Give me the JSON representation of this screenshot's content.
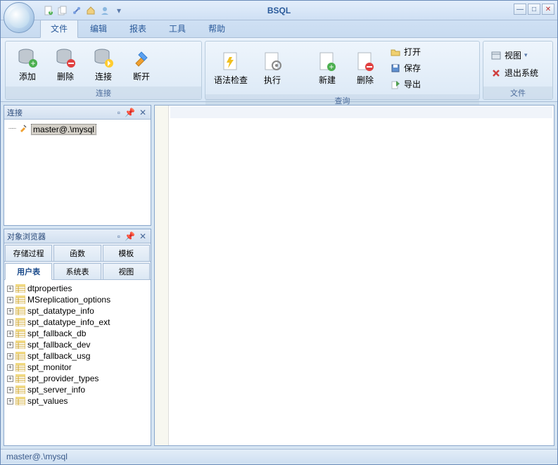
{
  "app": {
    "title": "BSQL"
  },
  "tabs": [
    "文件",
    "编辑",
    "报表",
    "工具",
    "帮助"
  ],
  "ribbon": {
    "conn_group": "连接",
    "query_group": "查询",
    "file_group": "文件",
    "add": "添加",
    "delete": "删除",
    "connect": "连接",
    "disconnect": "断开",
    "syntax": "语法检查",
    "execute": "执行",
    "new": "新建",
    "del2": "删除",
    "open": "打开",
    "save": "保存",
    "export": "导出",
    "view": "视图",
    "exit": "退出系统"
  },
  "panels": {
    "conn": "连接",
    "obj_browser": "对象浏览器"
  },
  "tree": {
    "node": "master@.\\mysql"
  },
  "obj_tabs_top": [
    "存储过程",
    "函数",
    "模板"
  ],
  "obj_tabs_bot": [
    "用户表",
    "系统表",
    "视图"
  ],
  "tables": [
    "dtproperties",
    "MSreplication_options",
    "spt_datatype_info",
    "spt_datatype_info_ext",
    "spt_fallback_db",
    "spt_fallback_dev",
    "spt_fallback_usg",
    "spt_monitor",
    "spt_provider_types",
    "spt_server_info",
    "spt_values"
  ],
  "status": "master@.\\mysql"
}
